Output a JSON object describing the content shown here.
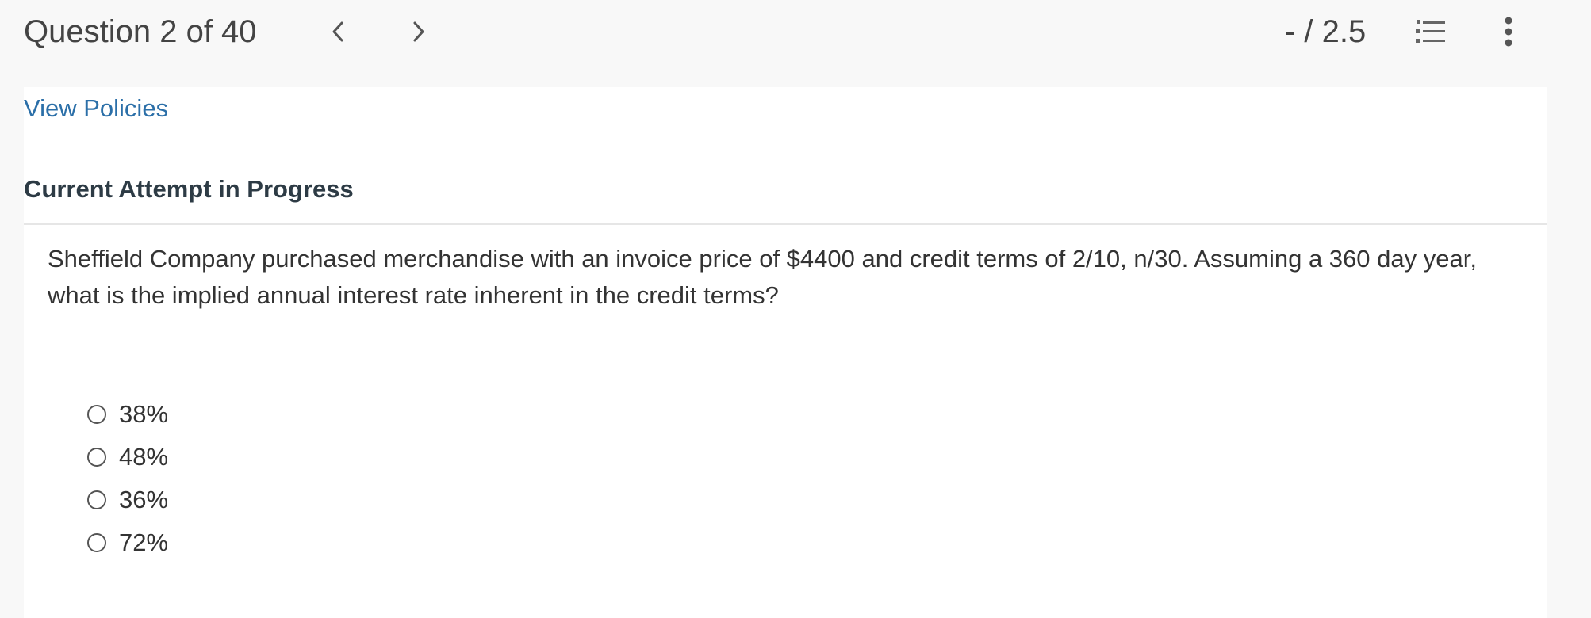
{
  "header": {
    "question_counter": "Question 2 of 40",
    "score": "- / 2.5",
    "prev_icon": "chevron-left-icon",
    "next_icon": "chevron-right-icon",
    "list_icon": "numbered-list-icon",
    "more_icon": "vertical-dots-icon"
  },
  "links": {
    "view_policies": "View Policies"
  },
  "attempt": {
    "heading": "Current Attempt in Progress"
  },
  "question": {
    "text": "Sheffield Company purchased merchandise with an invoice price of $4400 and credit terms of 2/10, n/30. Assuming a 360 day year, what is the implied annual interest rate inherent in the credit terms?",
    "options": [
      {
        "label": "38%"
      },
      {
        "label": "48%"
      },
      {
        "label": "36%"
      },
      {
        "label": "72%"
      }
    ]
  },
  "colors": {
    "link": "#2b6fa8",
    "heading": "#2d3b45",
    "page_background": "#f8f8f8",
    "content_background": "#ffffff"
  }
}
